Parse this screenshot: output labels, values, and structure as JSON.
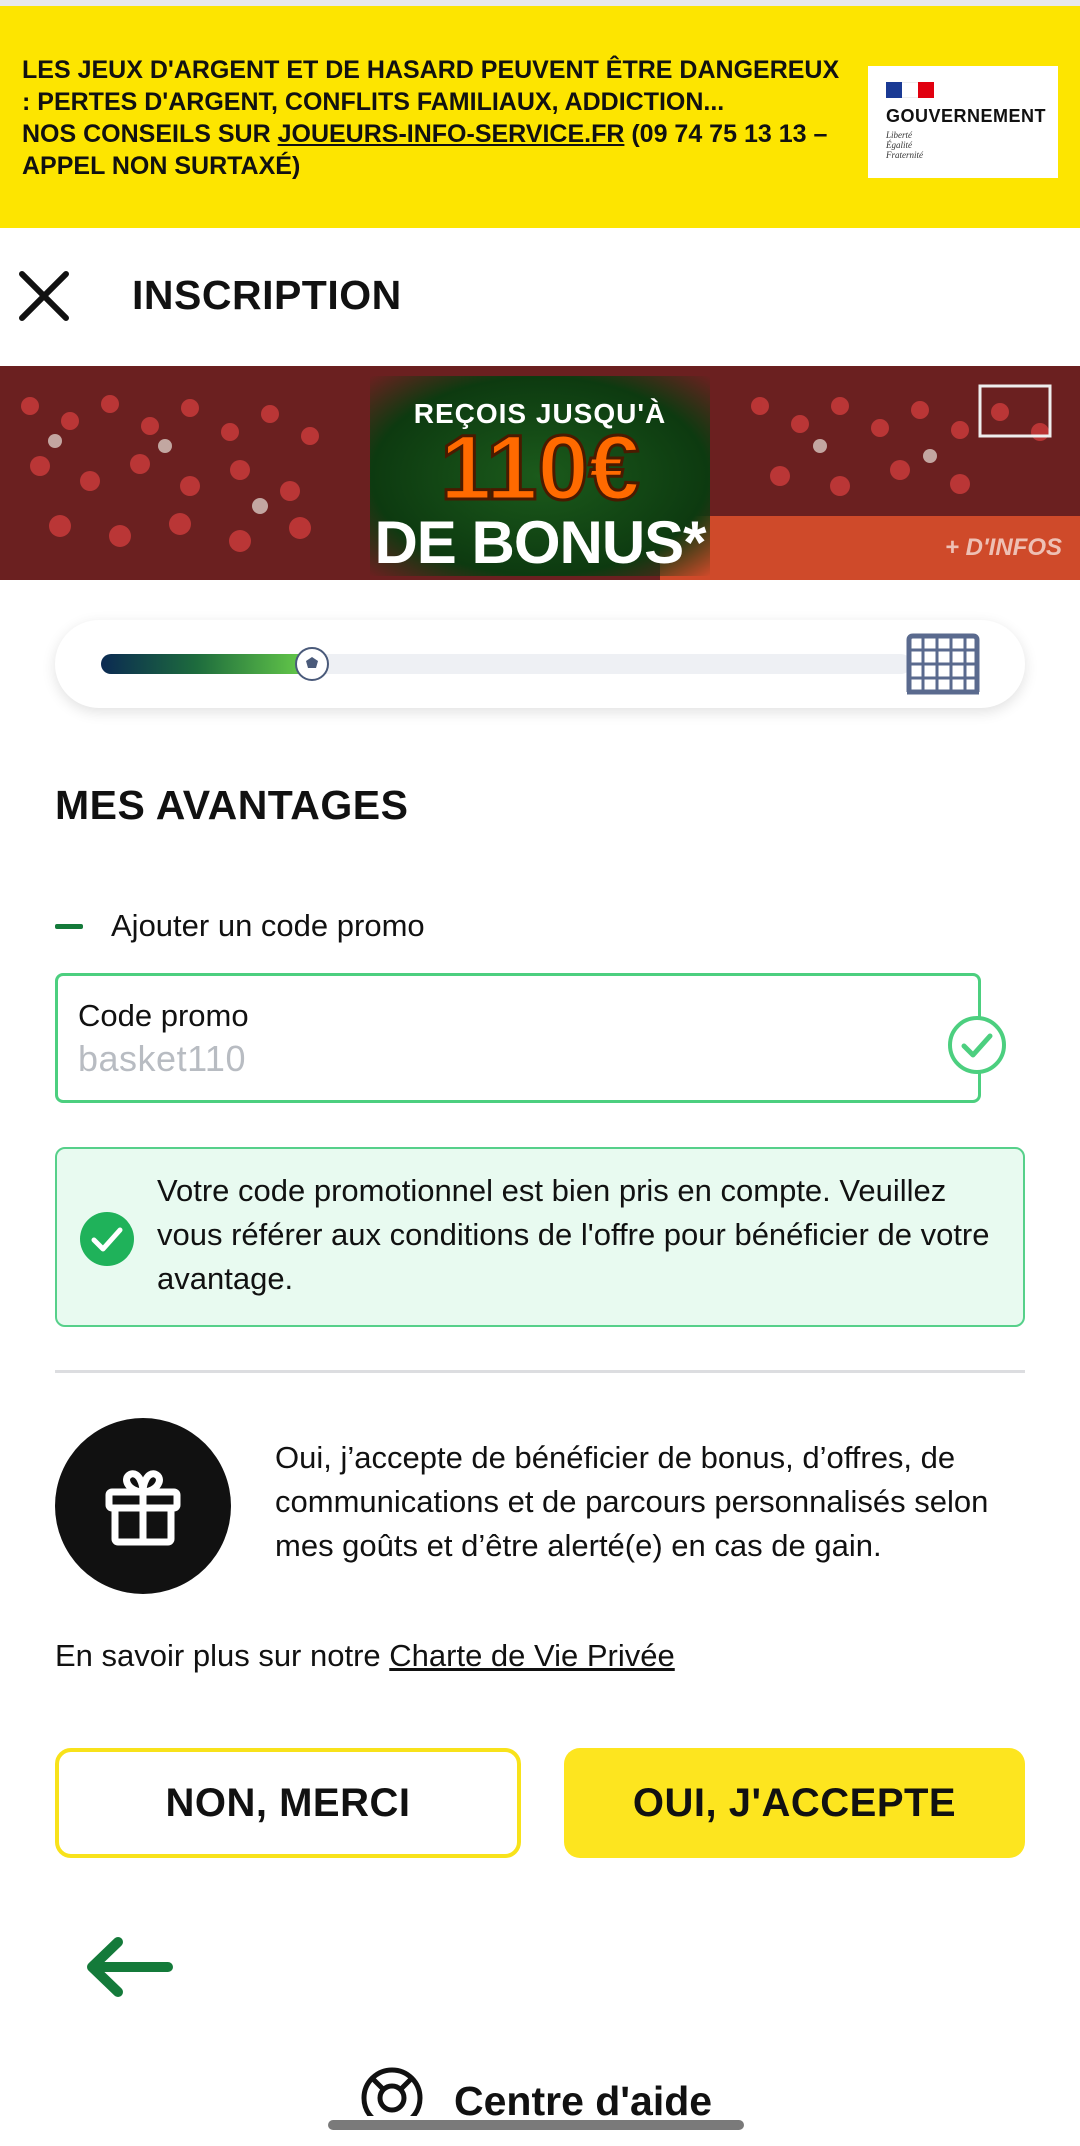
{
  "warning": {
    "line1": "LES JEUX D'ARGENT ET DE HASARD PEUVENT ÊTRE DANGEREUX : PERTES D'ARGENT, CONFLITS FAMILIAUX, ADDICTION...",
    "line2_prefix": "NOS CONSEILS SUR ",
    "line2_link": "JOUEURS-INFO-SERVICE.FR",
    "line2_suffix": " (09 74 75 13 13 – APPEL NON SURTAXÉ)",
    "gov_title": "GOUVERNEMENT",
    "gov_motto": [
      "Liberté",
      "Égalité",
      "Fraternité"
    ],
    "colors": {
      "background": "#fde500",
      "flag_blue": "#1a3a94",
      "flag_white": "#ffffff",
      "flag_red": "#e1000f"
    }
  },
  "header": {
    "close_icon": "close-icon",
    "title": "INSCRIPTION"
  },
  "banner": {
    "top_text": "REÇOIS JUSQU'À",
    "amount": "110€",
    "bottom_text": "DE BONUS*",
    "more": "+ D'INFOS"
  },
  "progress": {
    "fraction": 0.26,
    "marker_icon": "soccer-ball-icon",
    "goal_icon": "goal-net-icon"
  },
  "section": {
    "title": "MES AVANTAGES"
  },
  "promo": {
    "toggle_label": "Ajouter un code promo",
    "field_label": "Code promo",
    "field_value": "basket110",
    "valid": true,
    "accent_color": "#4ccf7f"
  },
  "success": {
    "message": "Votre code promotionnel est bien pris en compte. Veuillez vous référer aux conditions de l'offre pour bénéficier de votre avantage.",
    "icon": "check-circle-icon",
    "color": "#1fb25a"
  },
  "consent": {
    "icon": "gift-icon",
    "text": "Oui, j’accepte de bénéficier de bonus, d’offres, de communications et de parcours personnalisés selon mes goûts et d’être alerté(e) en cas de gain.",
    "privacy_prefix": "En savoir plus sur notre ",
    "privacy_link": "Charte de Vie Privée"
  },
  "buttons": {
    "decline": "NON, MERCI",
    "accept": "OUI, J'ACCEPTE",
    "accent_color": "#fde51f"
  },
  "footer": {
    "back_icon": "arrow-left-icon",
    "help_icon": "lifebuoy-icon",
    "help_label": "Centre d'aide"
  }
}
